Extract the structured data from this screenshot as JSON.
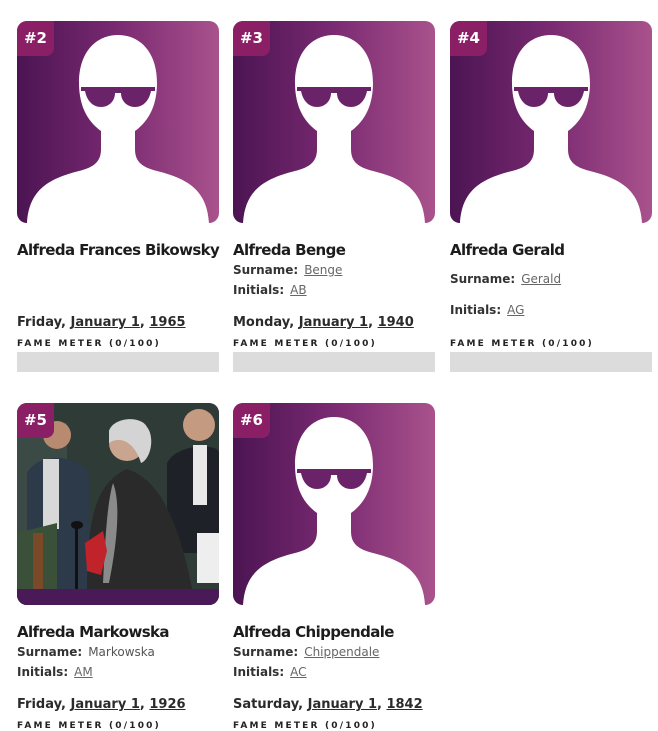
{
  "colors": {
    "accent": "#8b1f66",
    "gradient_start": "#4b1452",
    "gradient_end": "#a9528c",
    "fame_bar_bg": "#dcdcdc"
  },
  "cards": [
    {
      "rank": "#2",
      "name": "Alfreda Frances Bikowsky",
      "photo": "silhouette-placeholder",
      "date": {
        "weekday": "Friday,",
        "month_day": "January 1",
        "year": "1965"
      },
      "fame_label": "FAME METER (0/100)",
      "fame_value": 0
    },
    {
      "rank": "#3",
      "name": "Alfreda Benge",
      "photo": "silhouette-placeholder",
      "surname_label": "Surname:",
      "surname": "Benge",
      "initials_label": "Initials:",
      "initials": "AB",
      "date": {
        "weekday": "Monday,",
        "month_day": "January 1",
        "year": "1940"
      },
      "fame_label": "FAME METER (0/100)",
      "fame_value": 0
    },
    {
      "rank": "#4",
      "name": "Alfreda Gerald",
      "photo": "silhouette-placeholder",
      "surname_label": "Surname:",
      "surname": "Gerald",
      "initials_label": "Initials:",
      "initials": "AG",
      "fame_label": "FAME METER (0/100)",
      "fame_value": 0
    },
    {
      "rank": "#5",
      "name": "Alfreda Markowska",
      "photo": "portrait-photo",
      "surname_label": "Surname:",
      "surname": "Markowska",
      "initials_label": "Initials:",
      "initials": "AM",
      "date": {
        "weekday": "Friday,",
        "month_day": "January 1",
        "year": "1926"
      },
      "fame_label": "FAME METER (0/100)",
      "fame_value": 0
    },
    {
      "rank": "#6",
      "name": "Alfreda Chippendale",
      "photo": "silhouette-placeholder",
      "surname_label": "Surname:",
      "surname": "Chippendale",
      "initials_label": "Initials:",
      "initials": "AC",
      "date": {
        "weekday": "Saturday,",
        "month_day": "January 1",
        "year": "1842"
      },
      "fame_label": "FAME METER (0/100)",
      "fame_value": 0
    }
  ]
}
